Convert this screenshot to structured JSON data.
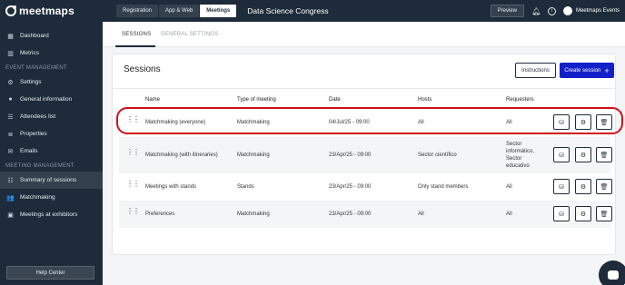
{
  "brand": {
    "name": "meetmaps"
  },
  "sidebar": {
    "top_items": [
      {
        "label": "Dashboard",
        "icon": "dashboard-icon"
      },
      {
        "label": "Metrics",
        "icon": "metrics-icon"
      }
    ],
    "event_management_label": "EVENT MANAGEMENT",
    "event_items": [
      {
        "label": "Settings",
        "icon": "gear-icon"
      },
      {
        "label": "General information",
        "icon": "info-icon"
      },
      {
        "label": "Attendees list",
        "icon": "attendees-icon"
      },
      {
        "label": "Properties",
        "icon": "properties-icon"
      },
      {
        "label": "Emails",
        "icon": "email-icon"
      }
    ],
    "meeting_management_label": "MEETING MANAGEMENT",
    "meeting_items": [
      {
        "label": "Summary of sessions",
        "icon": "list-icon",
        "active": true
      },
      {
        "label": "Matchmaking",
        "icon": "people-icon"
      },
      {
        "label": "Meetings at exhibitors",
        "icon": "exhibitors-icon"
      }
    ],
    "help_label": "Help Center"
  },
  "topbar": {
    "tabs": [
      {
        "label": "Registration"
      },
      {
        "label": "App & Web"
      },
      {
        "label": "Meetings",
        "active": true
      }
    ],
    "event_title": "Data Science Congress",
    "preview_label": "Preview",
    "user_name": "Meetmaps Events"
  },
  "subtabs": {
    "sessions": "SESSIONS",
    "general_settings": "GENERAL SETTINGS"
  },
  "card": {
    "title": "Sessions",
    "instructions_label": "Instructions",
    "create_label": "Create session",
    "create_icon": "+",
    "columns": [
      "Name",
      "Type of meeting",
      "Date",
      "Hosts",
      "Requesters"
    ],
    "rows": [
      {
        "name": "Matchmaking (everyone)",
        "type": "Matchmaking",
        "date": "04/Jul/25 - 09:00",
        "hosts": "All",
        "requesters": "All"
      },
      {
        "name": "Matchmaking (with itineraries)",
        "type": "Matchmaking",
        "date": "23/Apr/25 - 09:00",
        "hosts": "Sector científico",
        "requesters": "Sector informático, Sector educativo"
      },
      {
        "name": "Meetings with stands",
        "type": "Stands",
        "date": "23/Apr/25 - 09:00",
        "hosts": "Only stand members",
        "requesters": "All"
      },
      {
        "name": "Preferences",
        "type": "Matchmaking",
        "date": "23/Apr/25 - 09:00",
        "hosts": "All",
        "requesters": "All"
      }
    ]
  },
  "colors": {
    "sidebar": "#1d2b3a",
    "primary": "#1320c9",
    "highlight": "#d0101a"
  }
}
